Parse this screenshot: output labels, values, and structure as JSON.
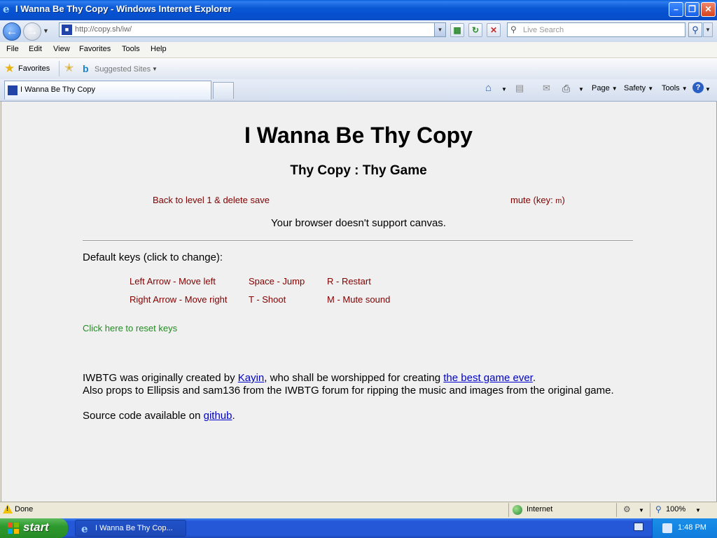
{
  "window": {
    "title": "I Wanna Be Thy Copy - Windows Internet Explorer",
    "controls": {
      "minimize": "–",
      "maximize": "❐",
      "close": "✕"
    }
  },
  "address_bar": {
    "url": "http://copy.sh/iw/",
    "search_placeholder": "Live Search"
  },
  "menu": [
    "File",
    "Edit",
    "View",
    "Favorites",
    "Tools",
    "Help"
  ],
  "favorites_bar": {
    "favorites_label": "Favorites",
    "suggested_label": "Suggested Sites"
  },
  "tabs": [
    {
      "label": "I Wanna Be Thy Copy"
    }
  ],
  "command_bar": {
    "page": "Page",
    "safety": "Safety",
    "tools": "Tools"
  },
  "page": {
    "title": "I Wanna Be Thy Copy",
    "subtitle": "Thy Copy : Thy Game",
    "back_link": "Back to level 1 & delete save",
    "mute_link": "mute (key: ",
    "mute_key": "m",
    "mute_close": ")",
    "canvas_message": "Your browser doesn't support canvas.",
    "keys_heading": "Default keys (click to change):",
    "keys": [
      [
        "Left Arrow - Move left",
        "Space - Jump",
        "R - Restart"
      ],
      [
        "Right Arrow - Move right",
        "T - Shoot",
        "M - Mute sound"
      ]
    ],
    "reset_keys": "Click here to reset keys",
    "credits": {
      "p1_before": "IWBTG was originally created by ",
      "p1_link1": "Kayin",
      "p1_middle": ", who shall be worshipped for creating ",
      "p1_link2": "the best game ever",
      "p1_after": ".",
      "p2": "Also props to Ellipsis and sam136 from the IWBTG forum for ripping the music and images from the original game.",
      "p3_before": "Source code available on ",
      "p3_link": "github",
      "p3_after": "."
    }
  },
  "status_bar": {
    "status": "Done",
    "zone": "Internet",
    "zoom": "100%"
  },
  "taskbar": {
    "start": "start",
    "task": "I Wanna Be Thy Cop...",
    "clock": "1:48 PM"
  },
  "colors": {
    "link_maroon": "#800000",
    "link_green": "#228b22",
    "link_blue": "#0000cc",
    "xp_blue": "#0a5fd8"
  }
}
